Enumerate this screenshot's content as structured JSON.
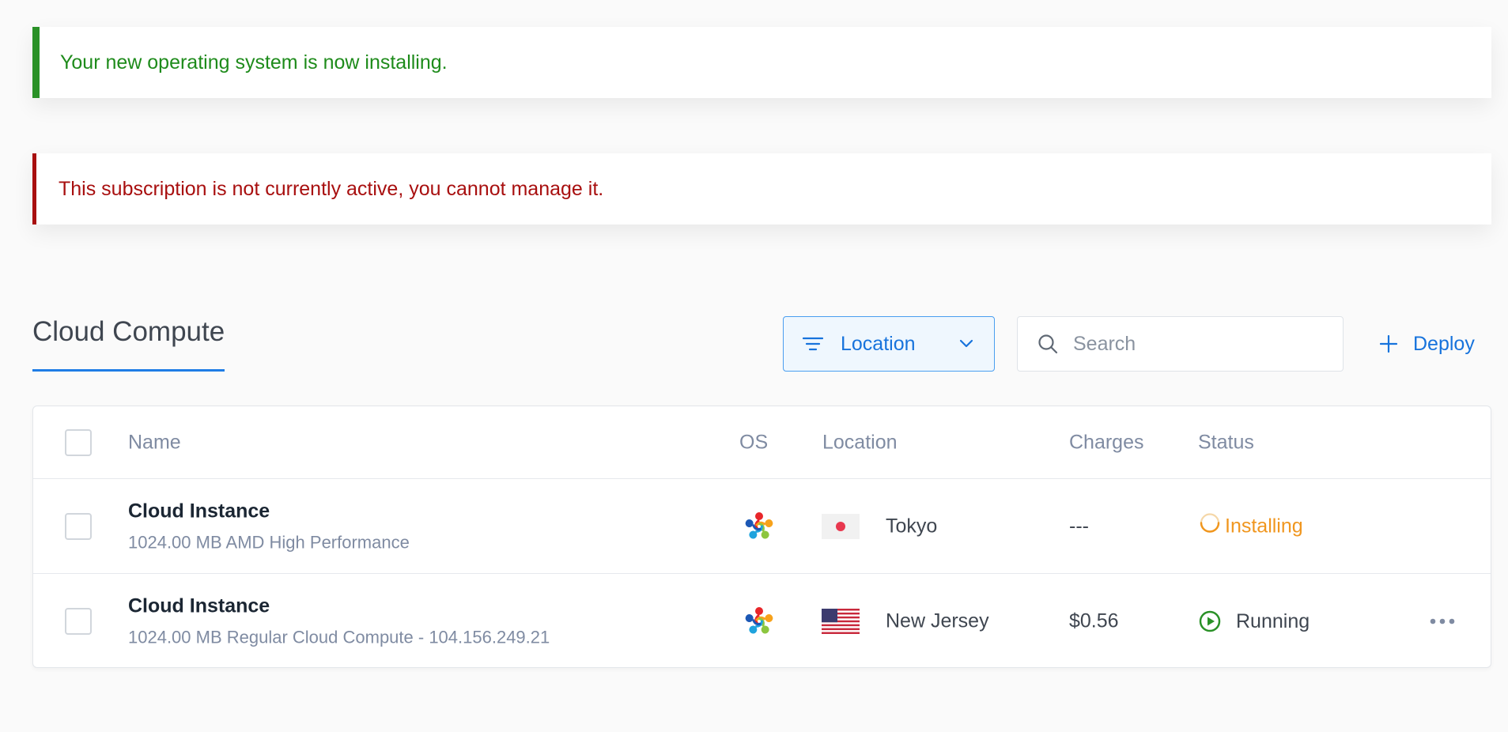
{
  "alerts": {
    "success": "Your new operating system is now installing.",
    "error": "This subscription is not currently active, you cannot manage it."
  },
  "section": {
    "title": "Cloud Compute"
  },
  "toolbar": {
    "filter_label": "Location",
    "search_placeholder": "Search",
    "deploy_label": "Deploy"
  },
  "table": {
    "headers": {
      "name": "Name",
      "os": "OS",
      "location": "Location",
      "charges": "Charges",
      "status": "Status"
    },
    "rows": [
      {
        "name": "Cloud Instance",
        "description": "1024.00 MB AMD High Performance",
        "os_icon": "os-flower-icon",
        "flag_icon": "japan-flag-icon",
        "location": "Tokyo",
        "charges": "---",
        "status": "Installing"
      },
      {
        "name": "Cloud Instance",
        "description": "1024.00 MB Regular Cloud Compute - 104.156.249.21",
        "os_icon": "os-flower-icon",
        "flag_icon": "us-flag-icon",
        "location": "New Jersey",
        "charges": "$0.56",
        "status": "Running"
      }
    ]
  },
  "colors": {
    "accent": "#1773dc",
    "success": "#1e8b1b",
    "error": "#a80f0f",
    "installing": "#f0961e",
    "running": "#2a9127"
  }
}
